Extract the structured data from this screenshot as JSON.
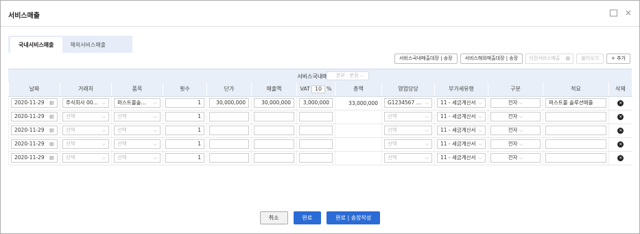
{
  "window": {
    "title": "서비스매출"
  },
  "tabs": [
    {
      "label": "국내서비스매출"
    },
    {
      "label": "해외서비스매출"
    }
  ],
  "toolbar": {
    "btn_domestic_ledger": "서비스국내매출대장 | 송장",
    "btn_overseas_ledger": "서비스해외매출대장 | 송장",
    "prev_placeholder": "이전서비스매출",
    "btn_load": "불러오기",
    "btn_add": "+ 추가"
  },
  "grid": {
    "title": "서비스국내매출대장",
    "mode_select": "본부 · 분점",
    "columns": [
      "날짜",
      "거래처",
      "품목",
      "횟수",
      "단가",
      "매출액",
      "VAT",
      "%",
      "총액",
      "영업담당",
      "부가세유형",
      "구분",
      "적요",
      "삭제"
    ],
    "vat_rate": "10",
    "rows": [
      {
        "date": "2020-11-29",
        "client": "주식회사 00…",
        "item": "퍼스트몰솔…",
        "count": "1",
        "unit_price": "30,000,000",
        "sales": "30,000,000",
        "vat": "3,000,000",
        "total": "33,000,000",
        "rep": "G1234567 …",
        "tax_type": "11 - 세금계산서",
        "division": "전자",
        "memo": "퍼스트몰 솔루션매출"
      },
      {
        "date": "2020-11-29",
        "client": "선택",
        "item": "선택",
        "count": "1",
        "unit_price": "",
        "sales": "",
        "vat": "",
        "total": "",
        "rep": "선택",
        "tax_type": "11 - 세금계산서",
        "division": "전자",
        "memo": ""
      },
      {
        "date": "2020-11-29",
        "client": "선택",
        "item": "선택",
        "count": "1",
        "unit_price": "",
        "sales": "",
        "vat": "",
        "total": "",
        "rep": "선택",
        "tax_type": "11 - 세금계산서",
        "division": "전자",
        "memo": ""
      },
      {
        "date": "2020-11-29",
        "client": "선택",
        "item": "선택",
        "count": "1",
        "unit_price": "",
        "sales": "",
        "vat": "",
        "total": "",
        "rep": "선택",
        "tax_type": "11 - 세금계산서",
        "division": "전자",
        "memo": ""
      },
      {
        "date": "2020-11-29",
        "client": "선택",
        "item": "선택",
        "count": "1",
        "unit_price": "",
        "sales": "",
        "vat": "",
        "total": "",
        "rep": "선택",
        "tax_type": "11 - 세금계산서",
        "division": "전자",
        "memo": ""
      }
    ]
  },
  "footer": {
    "cancel": "취소",
    "done": "완료",
    "done_invoice": "완료 | 송장작성"
  }
}
